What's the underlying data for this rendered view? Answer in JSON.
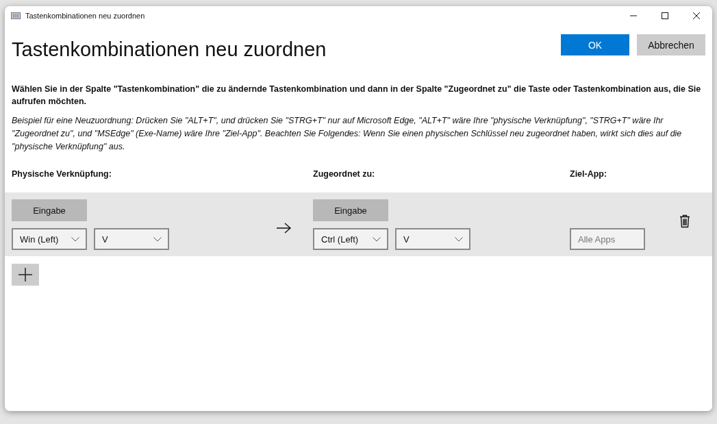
{
  "window": {
    "title": "Tastenkombinationen neu zuordnen"
  },
  "heading": "Tastenkombinationen neu zuordnen",
  "buttons": [
    {
      "label": "OK",
      "kind": "primary"
    },
    {
      "label": "Abbrechen",
      "kind": "secondary"
    }
  ],
  "instructions": "Wählen Sie in der Spalte \"Tastenkombination\" die zu ändernde Tastenkombination und dann in der Spalte \"Zugeordnet zu\" die Taste oder Tastenkombination aus, die Sie aufrufen möchten.",
  "example": "Beispiel für eine Neuzuordnung: Drücken Sie \"ALT+T\", und drücken Sie \"STRG+T\" nur auf Microsoft Edge, \"ALT+T\" wäre Ihre \"physische Verknüpfung\", \"STRG+T\" wäre Ihr \"Zugeordnet zu\", und \"MSEdge\" (Exe-Name) wäre Ihre \"Ziel-App\". Beachten Sie Folgendes: Wenn Sie einen physischen Schlüssel neu zugeordnet haben, wirkt sich dies auf die \"physische Verknüpfung\" aus.",
  "columns": [
    "Physische Verknüpfung:",
    "Zugeordnet zu:",
    "Ziel-App:"
  ],
  "mappings": [
    {
      "physical": {
        "button": "Eingabe",
        "keys": [
          "Win (Left)",
          "V"
        ]
      },
      "mapped": {
        "button": "Eingabe",
        "keys": [
          "Ctrl (Left)",
          "V"
        ]
      },
      "target_app": {
        "placeholder": "Alle Apps"
      }
    }
  ]
}
